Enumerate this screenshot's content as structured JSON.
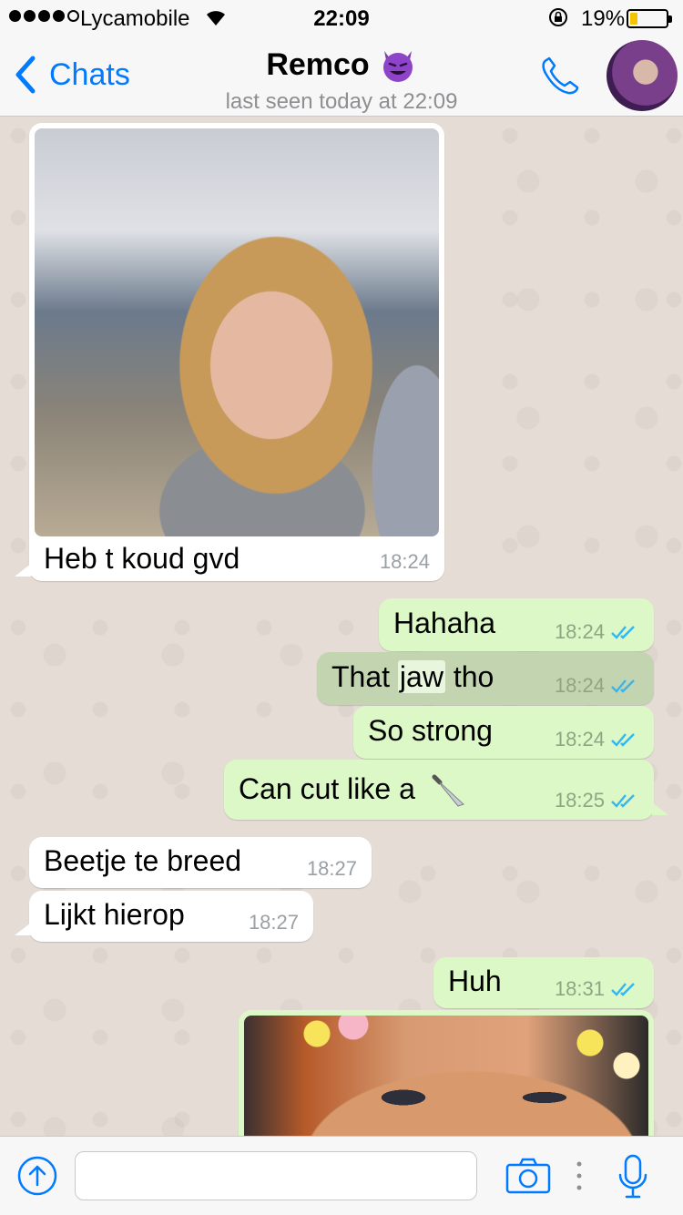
{
  "status_bar": {
    "signal_dots": 5,
    "signal_filled": 4,
    "carrier": "Lycamobile",
    "time": "22:09",
    "battery_percent": "19%",
    "battery_level": 0.19
  },
  "header": {
    "back_label": "Chats",
    "contact_name": "Remco",
    "contact_emoji": "smiling-devil-icon",
    "last_seen": "last seen today at 22:09"
  },
  "messages": [
    {
      "direction": "in",
      "type": "photo",
      "caption": "Heb t koud gvd",
      "time": "18:24"
    },
    {
      "direction": "out",
      "text": "Hahaha",
      "time": "18:24",
      "read": true
    },
    {
      "direction": "out",
      "text_before": "That ",
      "text_highlight": "jaw",
      "text_after": " tho",
      "time": "18:24",
      "read": true,
      "selected": true
    },
    {
      "direction": "out",
      "text": "So strong",
      "time": "18:24",
      "read": true
    },
    {
      "direction": "out",
      "text": "Can cut like a",
      "emoji": "knife-icon",
      "time": "18:25",
      "read": true
    },
    {
      "direction": "in",
      "text": "Beetje te breed",
      "time": "18:27"
    },
    {
      "direction": "in",
      "text": "Lijkt hierop",
      "time": "18:27"
    },
    {
      "direction": "out",
      "text": "Huh",
      "time": "18:31",
      "read": true
    },
    {
      "direction": "out",
      "type": "photo"
    }
  ],
  "input_bar": {
    "message_placeholder": ""
  },
  "colors": {
    "accent": "#007aff",
    "bubble_out": "#dcf8c6",
    "bubble_in": "#ffffff",
    "read_ticks": "#34b7f1",
    "chat_background": "#e5ddd5"
  }
}
